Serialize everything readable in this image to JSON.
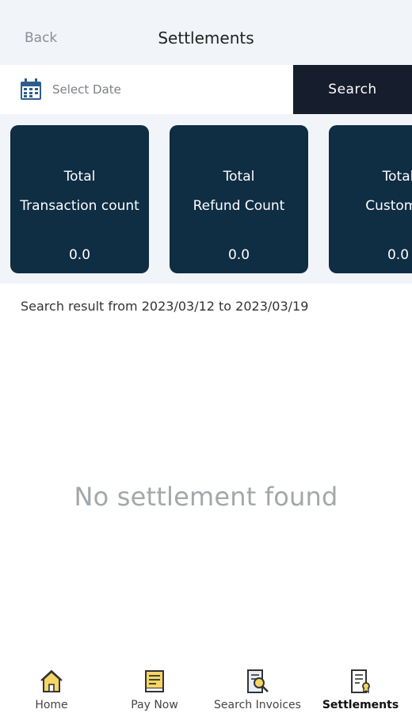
{
  "header": {
    "back_label": "Back",
    "title": "Settlements"
  },
  "search": {
    "date_placeholder": "Select Date",
    "search_label": "Search",
    "calendar_icon": "calendar-icon"
  },
  "cards": [
    {
      "line1": "Total",
      "line2": "Transaction count",
      "value": "0.0"
    },
    {
      "line1": "Total",
      "line2": "Refund Count",
      "value": "0.0"
    },
    {
      "line1": "Total",
      "line2": "Customer",
      "value": "0.0"
    }
  ],
  "result_text": "Search result from 2023/03/12 to 2023/03/19",
  "empty_message": "No settlement found",
  "tabs": [
    {
      "label": "Home",
      "icon": "home-icon"
    },
    {
      "label": "Pay Now",
      "icon": "receipt-icon"
    },
    {
      "label": "Search Invoices",
      "icon": "search-document-icon"
    },
    {
      "label": "Settlements",
      "icon": "settlement-document-icon",
      "active": true
    }
  ],
  "colors": {
    "card": "#0f2d43",
    "search_button": "#161d2c",
    "band": "#f1f4f8",
    "icon_yellow": "#f5d565",
    "calendar_blue": "#2e5d8f"
  }
}
